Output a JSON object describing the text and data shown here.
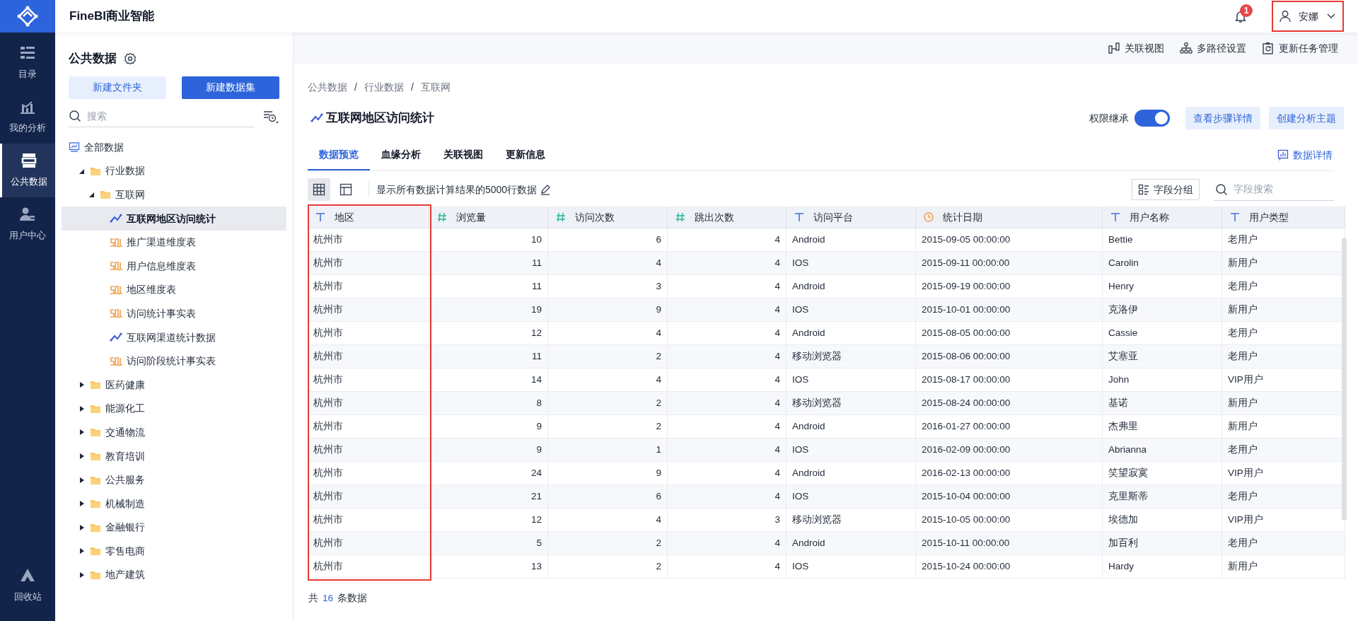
{
  "app": {
    "title": "FineBI商业智能",
    "notifications": "1",
    "user": "安娜"
  },
  "nav": [
    {
      "label": "目录",
      "selected": false
    },
    {
      "label": "我的分析",
      "selected": false
    },
    {
      "label": "公共数据",
      "selected": true
    },
    {
      "label": "用户中心",
      "selected": false
    }
  ],
  "nav_bottom": {
    "label": "回收站"
  },
  "sidebar": {
    "title": "公共数据",
    "buttons": [
      {
        "label": "新建文件夹",
        "kind": "secondary"
      },
      {
        "label": "新建数据集",
        "kind": "primary"
      }
    ],
    "search": {
      "placeholder": "搜索"
    },
    "tree": [
      {
        "label": "全部数据",
        "kind": "root",
        "children": [
          {
            "label": "行业数据",
            "kind": "folder",
            "expanded": true,
            "children": [
              {
                "label": "互联网",
                "kind": "folder",
                "expanded": true,
                "children": [
                  {
                    "label": "互联网地区访问统计",
                    "kind": "analysis",
                    "selected": true
                  },
                  {
                    "label": "推广渠道维度表",
                    "kind": "sql",
                    "selected": false
                  },
                  {
                    "label": "用户信息维度表",
                    "kind": "sql",
                    "selected": false
                  },
                  {
                    "label": "地区维度表",
                    "kind": "sql",
                    "selected": false
                  },
                  {
                    "label": "访问统计事实表",
                    "kind": "sql",
                    "selected": false
                  },
                  {
                    "label": "互联网渠道统计数据",
                    "kind": "analysis",
                    "selected": false
                  },
                  {
                    "label": "访问阶段统计事实表",
                    "kind": "sql",
                    "selected": false
                  }
                ]
              }
            ]
          },
          {
            "label": "医药健康",
            "kind": "folder",
            "expanded": false
          },
          {
            "label": "能源化工",
            "kind": "folder",
            "expanded": false
          },
          {
            "label": "交通物流",
            "kind": "folder",
            "expanded": false
          },
          {
            "label": "教育培训",
            "kind": "folder",
            "expanded": false
          },
          {
            "label": "公共服务",
            "kind": "folder",
            "expanded": false
          },
          {
            "label": "机械制造",
            "kind": "folder",
            "expanded": false
          },
          {
            "label": "金融银行",
            "kind": "folder",
            "expanded": false
          },
          {
            "label": "零售电商",
            "kind": "folder",
            "expanded": false
          },
          {
            "label": "地产建筑",
            "kind": "folder",
            "expanded": false
          }
        ]
      }
    ]
  },
  "toolbar": [
    {
      "label": "关联视图"
    },
    {
      "label": "多路径设置"
    },
    {
      "label": "更新任务管理"
    }
  ],
  "breadcrumb": [
    "公共数据",
    "行业数据",
    "互联网"
  ],
  "breadcrumb_separator": "/",
  "dataset": {
    "title": "互联网地区访问统计",
    "permission": {
      "label": "权限继承",
      "on": true
    },
    "actions": [
      "查看步骤详情",
      "创建分析主题"
    ]
  },
  "tabs": [
    {
      "label": "数据预览",
      "selected": true
    },
    {
      "label": "血缘分析",
      "selected": false
    },
    {
      "label": "关联视图",
      "selected": false
    },
    {
      "label": "更新信息",
      "selected": false
    }
  ],
  "details_link": "数据详情",
  "view_modes": [
    {
      "selected": true
    },
    {
      "selected": false
    }
  ],
  "row_note": "显示所有数据计算结果的5000行数据",
  "field_group": "字段分组",
  "field_search": {
    "placeholder": "字段搜索"
  },
  "table": {
    "columns": [
      {
        "label": "地区",
        "kind": "text"
      },
      {
        "label": "浏览量",
        "kind": "number"
      },
      {
        "label": "访问次数",
        "kind": "number"
      },
      {
        "label": "跳出次数",
        "kind": "number"
      },
      {
        "label": "访问平台",
        "kind": "text"
      },
      {
        "label": "统计日期",
        "kind": "date"
      },
      {
        "label": "用户名称",
        "kind": "text"
      },
      {
        "label": "用户类型",
        "kind": "text"
      }
    ],
    "rows": [
      [
        "杭州市",
        "10",
        "6",
        "4",
        "Android",
        "2015-09-05 00:00:00",
        "Bettie",
        "老用户"
      ],
      [
        "杭州市",
        "11",
        "4",
        "4",
        "IOS",
        "2015-09-11 00:00:00",
        "Carolin",
        "新用户"
      ],
      [
        "杭州市",
        "11",
        "3",
        "4",
        "Android",
        "2015-09-19 00:00:00",
        "Henry",
        "老用户"
      ],
      [
        "杭州市",
        "19",
        "9",
        "4",
        "IOS",
        "2015-10-01 00:00:00",
        "克洛伊",
        "新用户"
      ],
      [
        "杭州市",
        "12",
        "4",
        "4",
        "Android",
        "2015-08-05 00:00:00",
        "Cassie",
        "老用户"
      ],
      [
        "杭州市",
        "11",
        "2",
        "4",
        "移动浏览器",
        "2015-08-06 00:00:00",
        "艾塞亚",
        "老用户"
      ],
      [
        "杭州市",
        "14",
        "4",
        "4",
        "IOS",
        "2015-08-17 00:00:00",
        "John",
        "VIP用户"
      ],
      [
        "杭州市",
        "8",
        "2",
        "4",
        "移动浏览器",
        "2015-08-24 00:00:00",
        "基诺",
        "新用户"
      ],
      [
        "杭州市",
        "9",
        "2",
        "4",
        "Android",
        "2016-01-27 00:00:00",
        "杰弗里",
        "新用户"
      ],
      [
        "杭州市",
        "9",
        "1",
        "4",
        "IOS",
        "2016-02-09 00:00:00",
        "Abrianna",
        "老用户"
      ],
      [
        "杭州市",
        "24",
        "9",
        "4",
        "Android",
        "2016-02-13 00:00:00",
        "笑望寂寞",
        "VIP用户"
      ],
      [
        "杭州市",
        "21",
        "6",
        "4",
        "IOS",
        "2015-10-04 00:00:00",
        "克里斯蒂",
        "老用户"
      ],
      [
        "杭州市",
        "12",
        "4",
        "3",
        "移动浏览器",
        "2015-10-05 00:00:00",
        "埃德加",
        "VIP用户"
      ],
      [
        "杭州市",
        "5",
        "2",
        "4",
        "Android",
        "2015-10-11 00:00:00",
        "加百利",
        "老用户"
      ],
      [
        "杭州市",
        "13",
        "2",
        "4",
        "IOS",
        "2015-10-24 00:00:00",
        "Hardy",
        "新用户"
      ]
    ]
  },
  "footer": {
    "prefix": "共",
    "count": "16",
    "suffix": "条数据"
  }
}
